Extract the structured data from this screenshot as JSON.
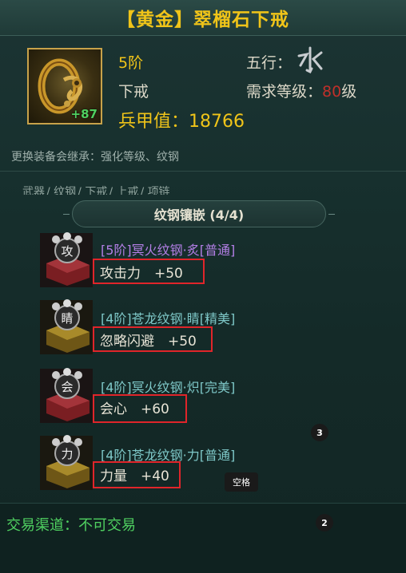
{
  "item": {
    "title": "【黄金】翠榴石下戒",
    "enhance": "+87",
    "tier": "5阶",
    "slot": "下戒",
    "element_label": "五行：",
    "element_icon": "water-glyph-icon",
    "level_label": "需求等级：",
    "level_value": "80",
    "level_suffix": "级",
    "armor_label": "兵甲值：18766",
    "inherit_text": "更换装备会继承：强化等级、纹钢"
  },
  "tabs": [
    "武器",
    "纹钢",
    "下戒",
    "上戒",
    "项链"
  ],
  "section": {
    "title": "纹钢镶嵌 (4/4)"
  },
  "gems": [
    {
      "glyph": "攻",
      "name": "[5阶]冥火纹钢·炙[普通]",
      "stat": "攻击力　+50",
      "name_color": "#b37fe6",
      "icon": "red-gem-icon"
    },
    {
      "glyph": "睛",
      "name": "[4阶]苍龙纹钢·睛[精美]",
      "stat": "忽略闪避　+50",
      "name_color": "#7ec8c8",
      "icon": "gold-gem-icon"
    },
    {
      "glyph": "会",
      "name": "[4阶]冥火纹钢·炽[完美]",
      "stat": "会心　+60",
      "name_color": "#7ec8c8",
      "icon": "red-gem-icon"
    },
    {
      "glyph": "力",
      "name": "[4阶]苍龙纹钢·力[普通]",
      "stat": "力量　+40",
      "name_color": "#7ec8c8",
      "icon": "gold-gem-icon"
    }
  ],
  "badges": {
    "b1": "3",
    "b2": "2",
    "space_tip": "空格"
  },
  "trade": {
    "text": "交易渠道：不可交易"
  },
  "colors": {
    "title": "#f0c419",
    "stat_box": "#e0252a",
    "trade": "#4fd060",
    "level_value": "#c0302a"
  }
}
